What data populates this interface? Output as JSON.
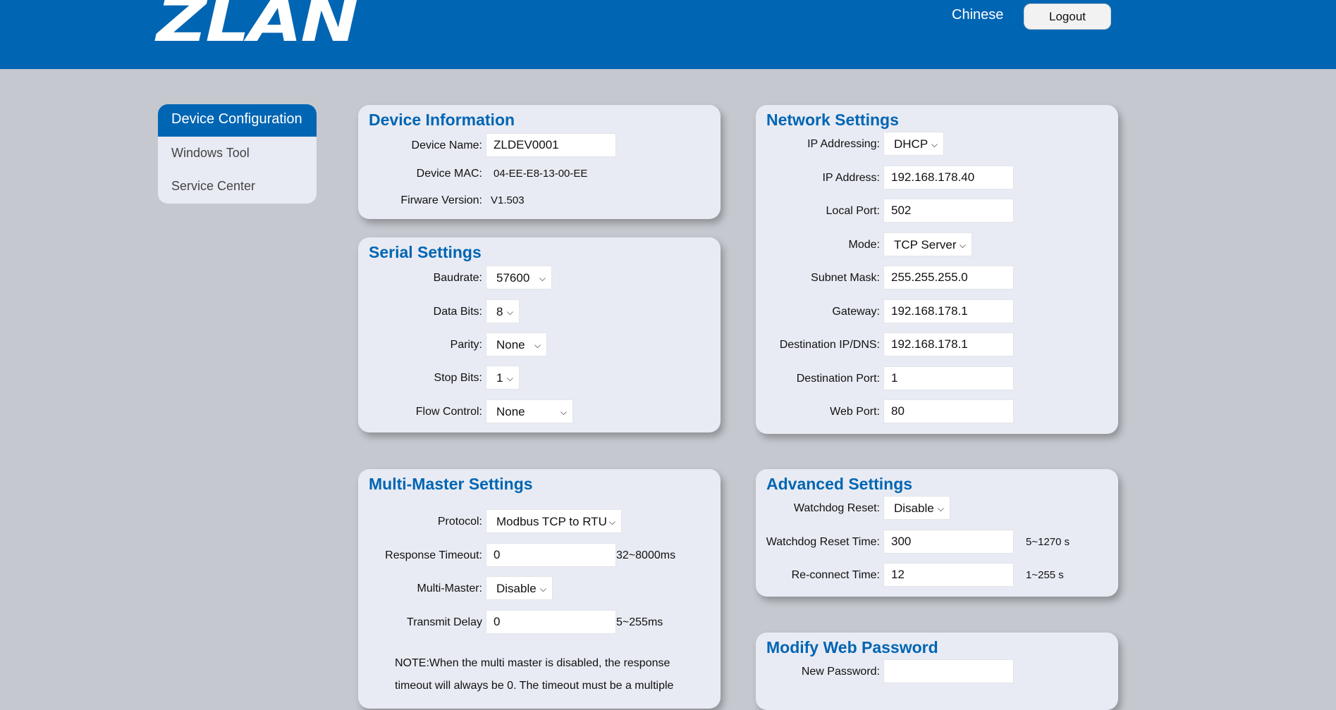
{
  "header": {
    "logo": "ZLAN",
    "language_link": "Chinese",
    "logout_label": "Logout"
  },
  "sidebar": {
    "items": [
      {
        "label": "Device Configuration",
        "active": true
      },
      {
        "label": "Windows Tool",
        "active": false
      },
      {
        "label": "Service Center",
        "active": false
      }
    ]
  },
  "device_info": {
    "title": "Device Information",
    "name_label": "Device Name:",
    "name_value": "ZLDEV0001",
    "mac_label": "Device MAC:",
    "mac_value": "04-EE-E8-13-00-EE",
    "firmware_label": "Firware Version:",
    "firmware_value": "V1.503"
  },
  "serial": {
    "title": "Serial Settings",
    "baudrate_label": "Baudrate:",
    "baudrate_value": "57600",
    "databits_label": "Data Bits:",
    "databits_value": "8",
    "parity_label": "Parity:",
    "parity_value": "None",
    "stopbits_label": "Stop Bits:",
    "stopbits_value": "1",
    "flow_label": "Flow Control:",
    "flow_value": "None"
  },
  "network": {
    "title": "Network Settings",
    "ip_mode_label": "IP Addressing:",
    "ip_mode_value": "DHCP",
    "ip_label": "IP Address:",
    "ip_value": "192.168.178.40",
    "local_port_label": "Local Port:",
    "local_port_value": "502",
    "mode_label": "Mode:",
    "mode_value": "TCP Server",
    "subnet_label": "Subnet Mask:",
    "subnet_value": "255.255.255.0",
    "gateway_label": "Gateway:",
    "gateway_value": "192.168.178.1",
    "dest_ip_label": "Destination IP/DNS:",
    "dest_ip_value": "192.168.178.1",
    "dest_port_label": "Destination Port:",
    "dest_port_value": "1",
    "web_port_label": "Web Port:",
    "web_port_value": "80"
  },
  "multimaster": {
    "title": "Multi-Master Settings",
    "protocol_label": "Protocol:",
    "protocol_value": "Modbus TCP to RTU",
    "timeout_label": "Response Timeout:",
    "timeout_value": "0",
    "timeout_unit": "32~8000ms",
    "mm_label": "Multi-Master:",
    "mm_value": "Disable",
    "delay_label": "Transmit Delay",
    "delay_value": "0",
    "delay_unit": "5~255ms",
    "note_line1": "NOTE:When the multi master is disabled, the response",
    "note_line2": "timeout will always be 0. The timeout must be a multiple"
  },
  "advanced": {
    "title": "Advanced Settings",
    "wd_reset_label": "Watchdog Reset:",
    "wd_reset_value": "Disable",
    "wd_time_label": "Watchdog Reset Time:",
    "wd_time_value": "300",
    "wd_time_unit": "5~1270 s",
    "reconnect_label": "Re-connect Time:",
    "reconnect_value": "12",
    "reconnect_unit": "1~255 s"
  },
  "password": {
    "title": "Modify Web Password",
    "new_label": "New Password:",
    "new_value": ""
  }
}
